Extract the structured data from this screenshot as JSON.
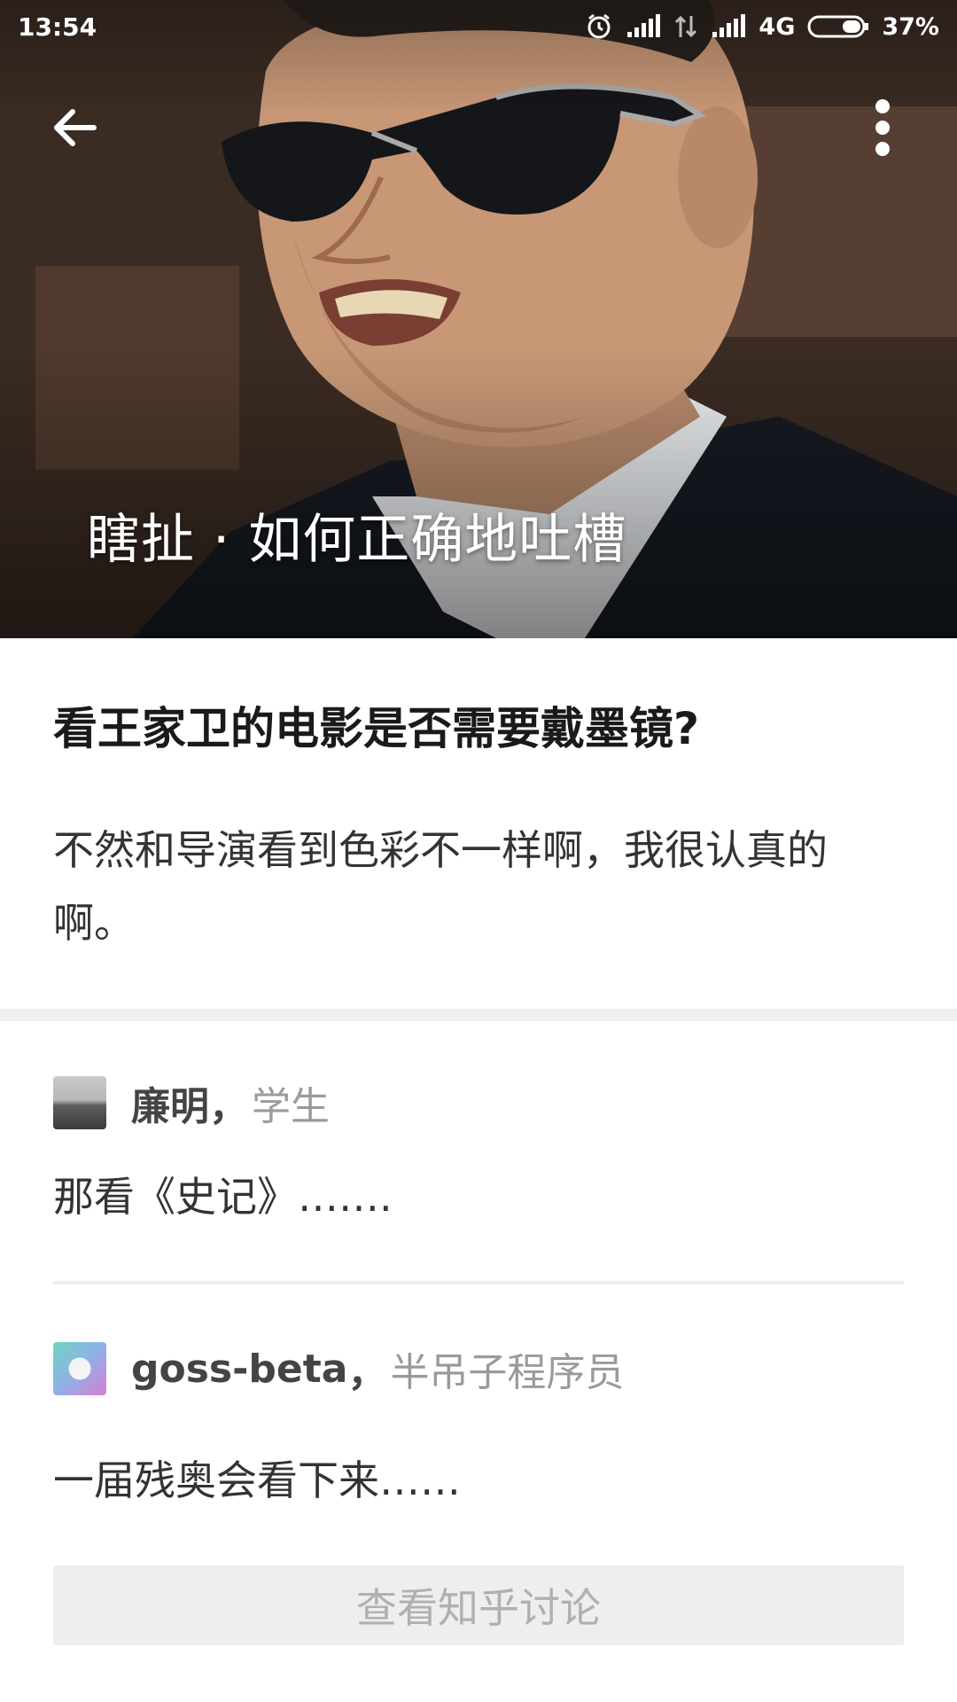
{
  "status_bar": {
    "time": "13:54",
    "network": "4G",
    "battery": "37%"
  },
  "header": {
    "column_title": "瞎扯 · 如何正确地吐槽"
  },
  "question": {
    "title": "看王家卫的电影是否需要戴墨镜?",
    "body": "不然和导演看到色彩不一样啊，我很认真的啊。"
  },
  "answers": [
    {
      "author": "廉明",
      "separator": "，",
      "bio": "学生",
      "text": "那看《史记》……."
    },
    {
      "author": "goss-beta",
      "separator": "，",
      "bio": "半吊子程序员",
      "text": "一届残奥会看下来……"
    }
  ],
  "footer": {
    "view_discussion_label": "查看知乎讨论"
  },
  "icons": {
    "back": "arrow-left-icon",
    "more": "more-vertical-icon",
    "alarm": "alarm-icon",
    "signal": "signal-icon",
    "battery": "battery-icon"
  },
  "colors": {
    "title_text": "#1a1a1a",
    "body_text": "#333333",
    "bio_text": "#9a9a9a",
    "button_bg": "#eeeeee",
    "button_text": "#b0b0b0"
  }
}
